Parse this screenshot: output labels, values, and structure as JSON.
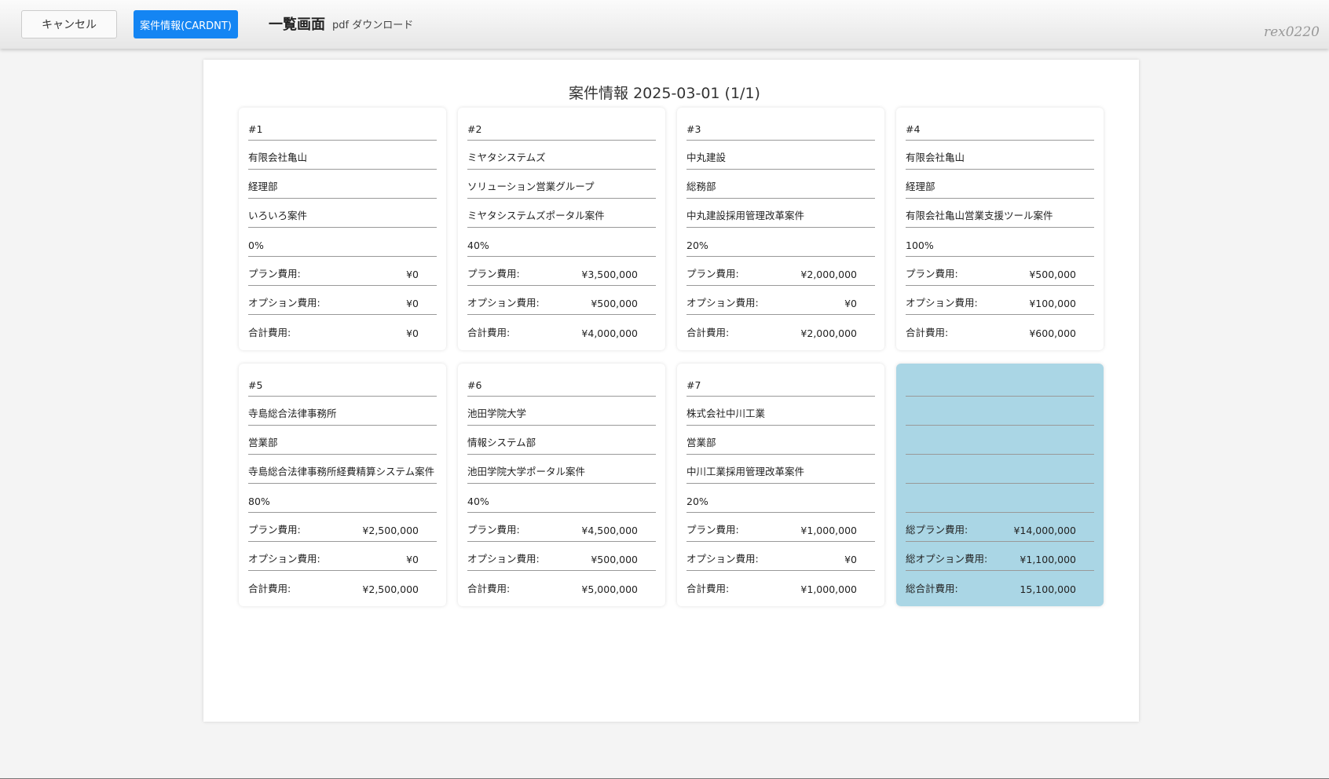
{
  "toolbar": {
    "cancel_label": "キャンセル",
    "card_label": "案件情報(CARDNT)",
    "screen_title": "一覧画面",
    "screen_subtitle": "pdf ダウンロード",
    "user": "rex0220"
  },
  "document": {
    "title": "案件情報 2025-03-01 (1/1)"
  },
  "labels": {
    "plan": "プラン費用:",
    "option": "オプション費用:",
    "total": "合計費用:",
    "sum_plan": "総プラン費用:",
    "sum_option": "総オプション費用:",
    "sum_total": "総合計費用:"
  },
  "cards": [
    {
      "no": "#1",
      "company": "有限会社亀山",
      "dept": "経理部",
      "project": "いろいろ案件",
      "progress": "0%",
      "plan": "¥0",
      "option": "¥0",
      "total": "¥0"
    },
    {
      "no": "#2",
      "company": "ミヤタシステムズ",
      "dept": "ソリューション営業グループ",
      "project": "ミヤタシステムズポータル案件",
      "progress": "40%",
      "plan": "¥3,500,000",
      "option": "¥500,000",
      "total": "¥4,000,000"
    },
    {
      "no": "#3",
      "company": "中丸建設",
      "dept": "総務部",
      "project": "中丸建設採用管理改革案件",
      "progress": "20%",
      "plan": "¥2,000,000",
      "option": "¥0",
      "total": "¥2,000,000"
    },
    {
      "no": "#4",
      "company": "有限会社亀山",
      "dept": "経理部",
      "project": "有限会社亀山営業支援ツール案件",
      "progress": "100%",
      "plan": "¥500,000",
      "option": "¥100,000",
      "total": "¥600,000"
    },
    {
      "no": "#5",
      "company": "寺島総合法律事務所",
      "dept": "営業部",
      "project": "寺島総合法律事務所経費精算システム案件",
      "progress": "80%",
      "plan": "¥2,500,000",
      "option": "¥0",
      "total": "¥2,500,000"
    },
    {
      "no": "#6",
      "company": "池田学院大学",
      "dept": "情報システム部",
      "project": "池田学院大学ポータル案件",
      "progress": "40%",
      "plan": "¥4,500,000",
      "option": "¥500,000",
      "total": "¥5,000,000"
    },
    {
      "no": "#7",
      "company": "株式会社中川工業",
      "dept": "営業部",
      "project": "中川工業採用管理改革案件",
      "progress": "20%",
      "plan": "¥1,000,000",
      "option": "¥0",
      "total": "¥1,000,000"
    }
  ],
  "summary": {
    "plan": "¥14,000,000",
    "option": "¥1,100,000",
    "total": "15,100,000"
  },
  "colors": {
    "primary": "#1485f3",
    "summary_bg": "#aad6e5"
  }
}
